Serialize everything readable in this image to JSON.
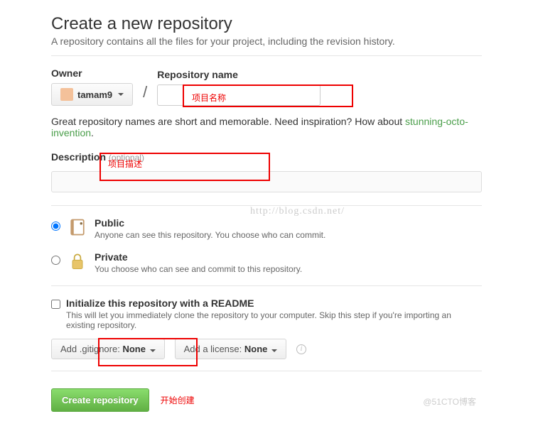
{
  "header": {
    "title": "Create a new repository",
    "subtitle": "A repository contains all the files for your project, including the revision history."
  },
  "owner": {
    "label": "Owner",
    "username": "tamam9"
  },
  "repo": {
    "label": "Repository name",
    "value": ""
  },
  "hint": {
    "text_before": "Great repository names are short and memorable. Need inspiration? How about ",
    "suggestion": "stunning-octo-invention",
    "text_after": "."
  },
  "description": {
    "label": "Description",
    "optional": "(optional)",
    "value": ""
  },
  "visibility": {
    "public": {
      "title": "Public",
      "sub": "Anyone can see this repository. You choose who can commit."
    },
    "private": {
      "title": "Private",
      "sub": "You choose who can see and commit to this repository."
    }
  },
  "init": {
    "title": "Initialize this repository with a README",
    "sub": "This will let you immediately clone the repository to your computer. Skip this step if you're importing an existing repository."
  },
  "dropdowns": {
    "gitignore_prefix": "Add .gitignore: ",
    "gitignore_value": "None",
    "license_prefix": "Add a license: ",
    "license_value": "None"
  },
  "submit": {
    "label": "Create repository"
  },
  "annotations": {
    "name": "项目名称",
    "desc": "项目描述",
    "create": "开始创建"
  },
  "watermark": {
    "url": "http://blog.csdn.net/",
    "corner": "@51CTO博客"
  }
}
